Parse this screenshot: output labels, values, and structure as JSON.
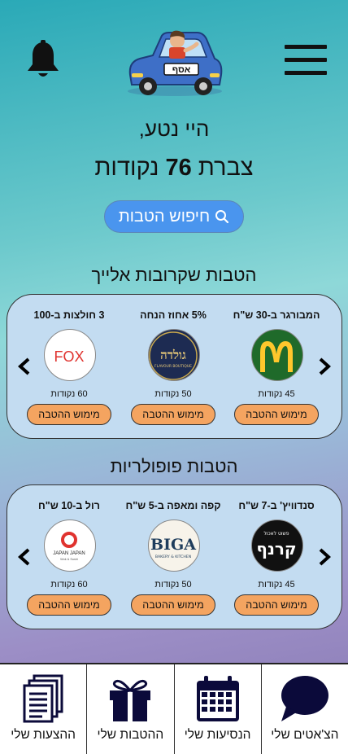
{
  "header": {
    "bell_icon": "bell-icon",
    "menu_icon": "hamburger-menu-icon",
    "logo_text": "אסף"
  },
  "greeting": "היי נטע,",
  "points": {
    "prefix": "צברת",
    "value": "76",
    "suffix": "נקודות"
  },
  "search": {
    "label": "חיפוש הטבות",
    "icon": "search-icon"
  },
  "nearby": {
    "title": "הטבות שקרובות אלייך",
    "offers": [
      {
        "title": "המבורגר ב-30 ש\"ח",
        "points": "45 נקודות",
        "button": "מימוש ההטבה",
        "brand": "McDonald's"
      },
      {
        "title": "5% אחוז הנחה",
        "points": "50 נקודות",
        "button": "מימוש ההטבה",
        "brand": "גולדה",
        "brand_sub": "FLAVOUR BOUTIQUE"
      },
      {
        "title": "3 חולצות ב-100",
        "points": "60 נקודות",
        "button": "מימוש ההטבה",
        "brand": "FOX"
      }
    ]
  },
  "popular": {
    "title": "הטבות פופולריות",
    "offers": [
      {
        "title": "סנדוויץ' ב-7 ש\"ח",
        "points": "45 נקודות",
        "button": "מימוש ההטבה",
        "brand": "קרנף",
        "brand_sub": "פשוט לאכול"
      },
      {
        "title": "קפה ומאפה ב-5 ש\"ח",
        "points": "50 נקודות",
        "button": "מימוש ההטבה",
        "brand": "BIGA",
        "brand_sub": "BAKERY & KITCHEN"
      },
      {
        "title": "רול ב-10 ש\"ח",
        "points": "60 נקודות",
        "button": "מימוש ההטבה",
        "brand": "JAPAN JAPAN",
        "brand_sub": "Wok & Sushi"
      }
    ]
  },
  "nav": [
    {
      "label": "הצ'אטים שלי",
      "icon": "chat-bubble-icon"
    },
    {
      "label": "הנסיעות שלי",
      "icon": "calendar-icon"
    },
    {
      "label": "ההטבות שלי",
      "icon": "gift-icon"
    },
    {
      "label": "ההצעות שלי",
      "icon": "documents-icon"
    }
  ],
  "colors": {
    "card_bg": "#c3dcf1",
    "button_orange": "#f4a460",
    "search_blue": "#4a95ee",
    "nav_icon": "#0b0a3a"
  }
}
